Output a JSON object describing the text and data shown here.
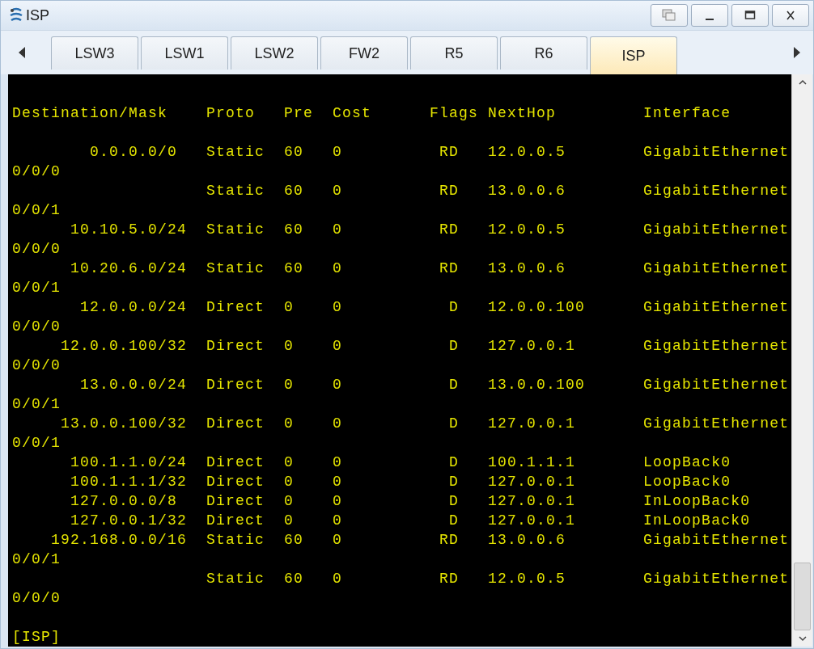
{
  "window": {
    "title": "ISP"
  },
  "tabs": [
    {
      "label": "LSW3",
      "selected": false
    },
    {
      "label": "LSW1",
      "selected": false
    },
    {
      "label": "LSW2",
      "selected": false
    },
    {
      "label": "FW2",
      "selected": false
    },
    {
      "label": "R5",
      "selected": false
    },
    {
      "label": "R6",
      "selected": false
    },
    {
      "label": "ISP",
      "selected": true
    }
  ],
  "terminal": {
    "blocks": [
      [
        "Destination/Mask    Proto   Pre  Cost      Flags NextHop         Interface"
      ],
      [
        "        0.0.0.0/0   Static  60   0          RD   12.0.0.5        GigabitEthernet",
        "0/0/0",
        "                    Static  60   0          RD   13.0.0.6        GigabitEthernet",
        "0/0/1",
        "      10.10.5.0/24  Static  60   0          RD   12.0.0.5        GigabitEthernet",
        "0/0/0",
        "      10.20.6.0/24  Static  60   0          RD   13.0.0.6        GigabitEthernet",
        "0/0/1",
        "       12.0.0.0/24  Direct  0    0           D   12.0.0.100      GigabitEthernet",
        "0/0/0",
        "     12.0.0.100/32  Direct  0    0           D   127.0.0.1       GigabitEthernet",
        "0/0/0",
        "       13.0.0.0/24  Direct  0    0           D   13.0.0.100      GigabitEthernet",
        "0/0/1",
        "     13.0.0.100/32  Direct  0    0           D   127.0.0.1       GigabitEthernet",
        "0/0/1",
        "      100.1.1.0/24  Direct  0    0           D   100.1.1.1       LoopBack0",
        "      100.1.1.1/32  Direct  0    0           D   127.0.0.1       LoopBack0",
        "      127.0.0.0/8   Direct  0    0           D   127.0.0.1       InLoopBack0",
        "      127.0.0.1/32  Direct  0    0           D   127.0.0.1       InLoopBack0",
        "    192.168.0.0/16  Static  60   0          RD   13.0.0.6        GigabitEthernet",
        "0/0/1",
        "                    Static  60   0          RD   12.0.0.5        GigabitEthernet",
        "0/0/0"
      ],
      [
        "[ISP]"
      ]
    ]
  }
}
